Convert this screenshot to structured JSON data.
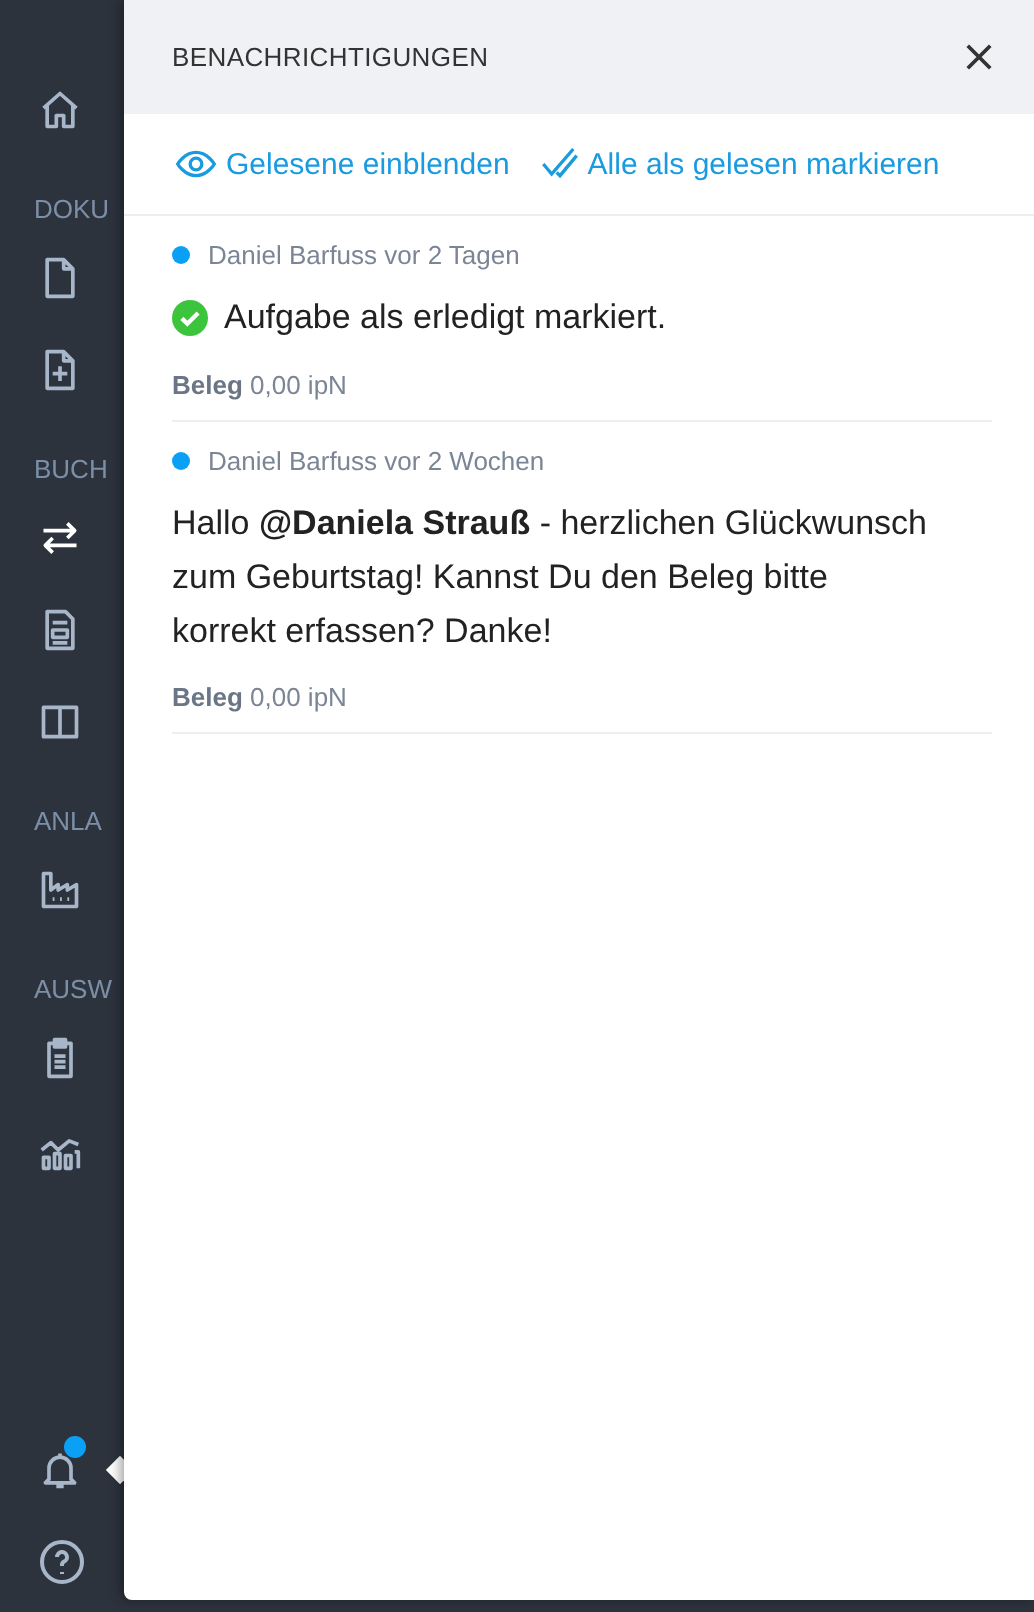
{
  "sidebar": {
    "items": [
      {
        "kind": "home",
        "selected": false
      },
      {
        "kind": "label",
        "text": "DOKU"
      },
      {
        "kind": "document",
        "selected": false
      },
      {
        "kind": "document-plus",
        "selected": false
      },
      {
        "kind": "label",
        "text": "BUCH"
      },
      {
        "kind": "transfer",
        "selected": true
      },
      {
        "kind": "report",
        "selected": false
      },
      {
        "kind": "columns",
        "selected": false
      },
      {
        "kind": "label",
        "text": "ANLA"
      },
      {
        "kind": "factory",
        "selected": false
      },
      {
        "kind": "label",
        "text": "AUSW"
      },
      {
        "kind": "clipboard",
        "selected": false
      },
      {
        "kind": "chart",
        "selected": false
      }
    ],
    "bottom": [
      {
        "kind": "bell",
        "badge": true
      },
      {
        "kind": "help"
      }
    ]
  },
  "panel": {
    "title": "BENACHRICHTIGUNGEN",
    "actions": [
      {
        "kind": "eye",
        "label": "Gelesene einblenden"
      },
      {
        "kind": "check",
        "label": "Alle als gelesen markieren"
      }
    ],
    "notifications": [
      {
        "unread": true,
        "meta": "Daniel Barfuss vor 2 Tagen",
        "kind": "done",
        "text": "Aufgabe als erledigt markiert.",
        "footer": "**Beleg** 0,00 ipN"
      },
      {
        "unread": true,
        "meta": "Daniel Barfuss vor 2 Wochen",
        "kind": "message",
        "text": "Hallo **@Daniela Strauß** - herzlichen Glückwunsch zum Geburtstag! Kannst Du den Beleg bitte korrekt erfassen? Danke!",
        "footer": "**Beleg** 0,00 ipN"
      }
    ]
  }
}
